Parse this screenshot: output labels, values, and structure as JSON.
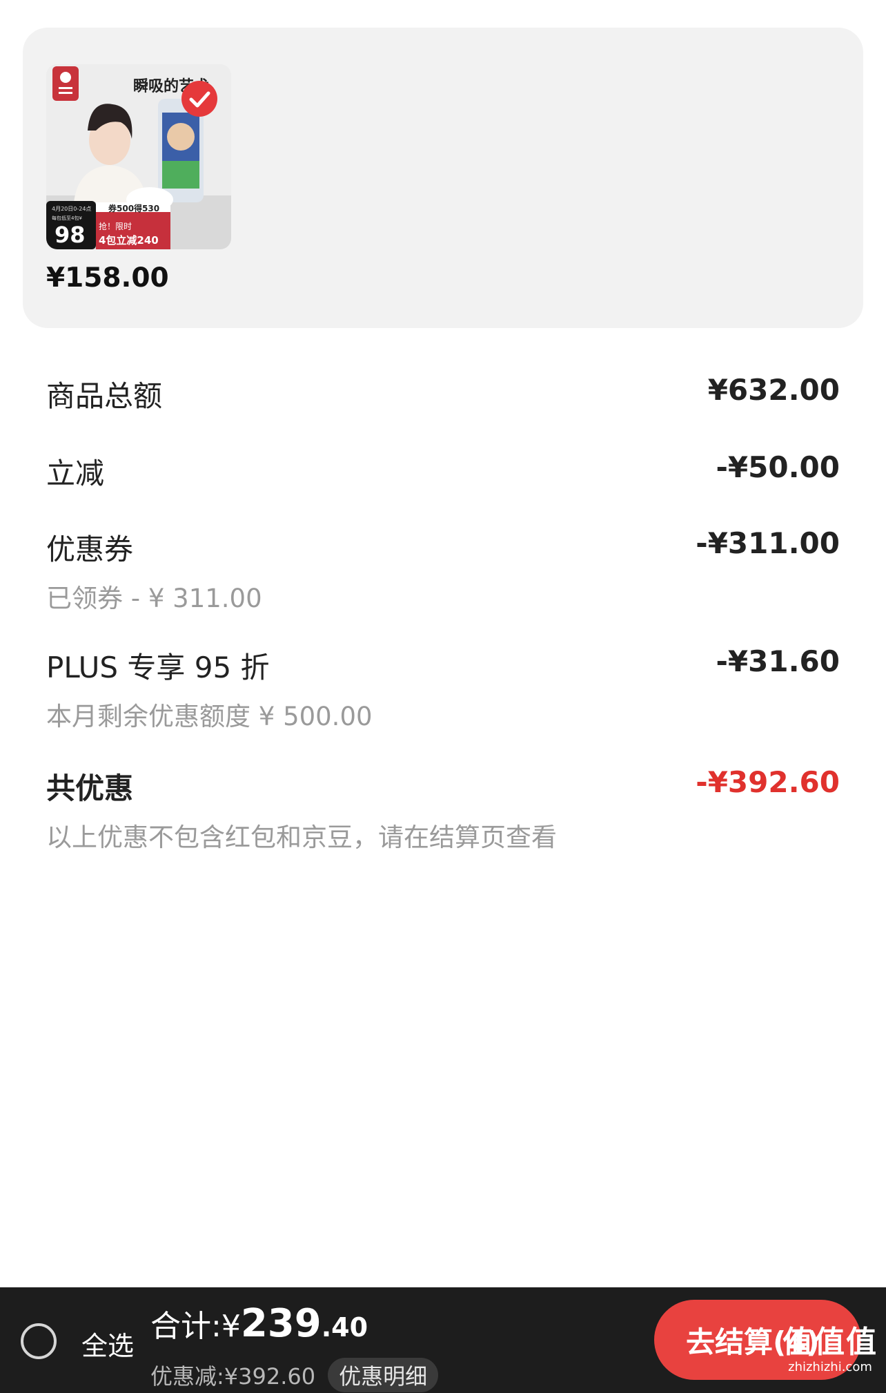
{
  "product": {
    "image": {
      "headline": "瞬吸的艺术",
      "date_text": "4月20日0-24点",
      "price_big": "98",
      "tag_prefix": "每包低至4包¥",
      "tag_promo_top": "券500得530",
      "tag_promo_line1": "抢！限时",
      "tag_promo_line2": "4包立减240",
      "brand_logo": "babycare-logo",
      "check_icon": "check-icon"
    },
    "price": "¥158.00"
  },
  "summary": {
    "goods_total": {
      "label": "商品总额",
      "value": "¥632.00"
    },
    "instant_cut": {
      "label": "立减",
      "value": "-¥50.00"
    },
    "coupon": {
      "label": "优惠券",
      "value": "-¥311.00",
      "sub": "已领券 - ¥ 311.00"
    },
    "plus": {
      "label": "PLUS 专享 95 折",
      "value": "-¥31.60",
      "sub": "本月剩余优惠额度 ¥ 500.00"
    },
    "total_discount": {
      "label": "共优惠",
      "value": "-¥392.60",
      "sub": "以上优惠不包含红包和京豆，请在结算页查看"
    }
  },
  "bottom_bar": {
    "select_all": "全选",
    "total_label": "合计:¥",
    "total_int": "239",
    "total_dec": ".40",
    "saving_text": "优惠减:¥392.60",
    "detail_btn": "优惠明细",
    "checkout_btn": "去结算(4)"
  },
  "watermark": {
    "logo": "值值值",
    "url": "zhizhizhi.com"
  },
  "colors": {
    "accent": "#e8423f",
    "discount_red": "#e0312d",
    "bar_bg": "#1d1d1d",
    "card_bg": "#f2f2f2"
  }
}
